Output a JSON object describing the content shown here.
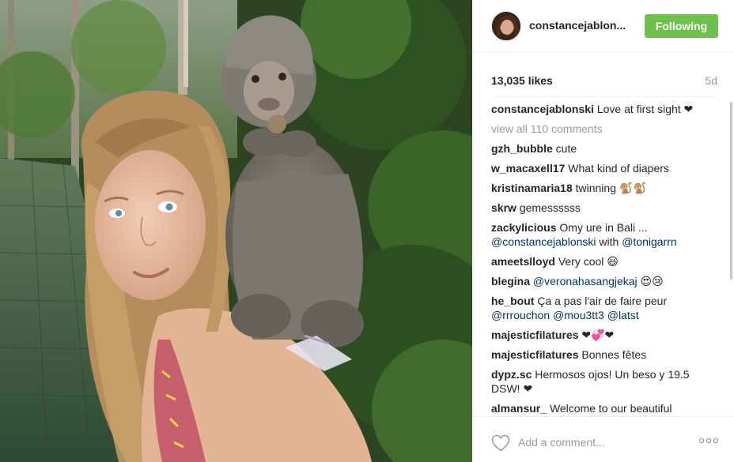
{
  "post": {
    "username": "constancejablon...",
    "follow_label": "Following",
    "likes": "13,035 likes",
    "age": "5d"
  },
  "caption": {
    "user": "constancejablonski",
    "text": "Love at first sight ❤"
  },
  "view_all": "view all 110 comments",
  "comments": [
    {
      "user": "gzh_bubble",
      "text": "cute"
    },
    {
      "user": "w_macaxell17",
      "text": "What kind of diapers"
    },
    {
      "user": "kristinamaria18",
      "text": "twinning 🐒🐒"
    },
    {
      "user": "skrw",
      "text": "gemessssss"
    },
    {
      "user": "zackylicious",
      "text": "Omy ure in Bali ...",
      "line2_mention1": "@constancejablonski",
      "line2_mid": " with ",
      "line2_mention2": "@tonigarrn"
    },
    {
      "user": "ameetslloyd",
      "text": "Very cool 😃"
    },
    {
      "user": "blegina",
      "mention": "@veronahasangjekaj",
      "text": " 😍😢"
    },
    {
      "user": "he_bout",
      "text": "Ça a pas l'air de faire peur",
      "line2_mention1": "@rrrouchon",
      "line2_mention2": "@mou3tt3",
      "line2_mention3": "@latst"
    },
    {
      "user": "majesticfilatures",
      "text": "❤💞❤"
    },
    {
      "user": "majesticfilatures",
      "text": "Bonnes fêtes"
    },
    {
      "user": "dypz.sc",
      "text": "Hermosos ojos! Un beso y 19.5 DSW! ❤"
    },
    {
      "user": "almansur_",
      "text": "Welcome to our beautiful"
    }
  ],
  "footer": {
    "comment_placeholder": "Add a comment...",
    "like_icon": "heart-outline-icon",
    "more_icon": "more-options-icon"
  },
  "colors": {
    "follow_green": "#70c050",
    "mention_blue": "#003569",
    "muted_gray": "#999999"
  }
}
